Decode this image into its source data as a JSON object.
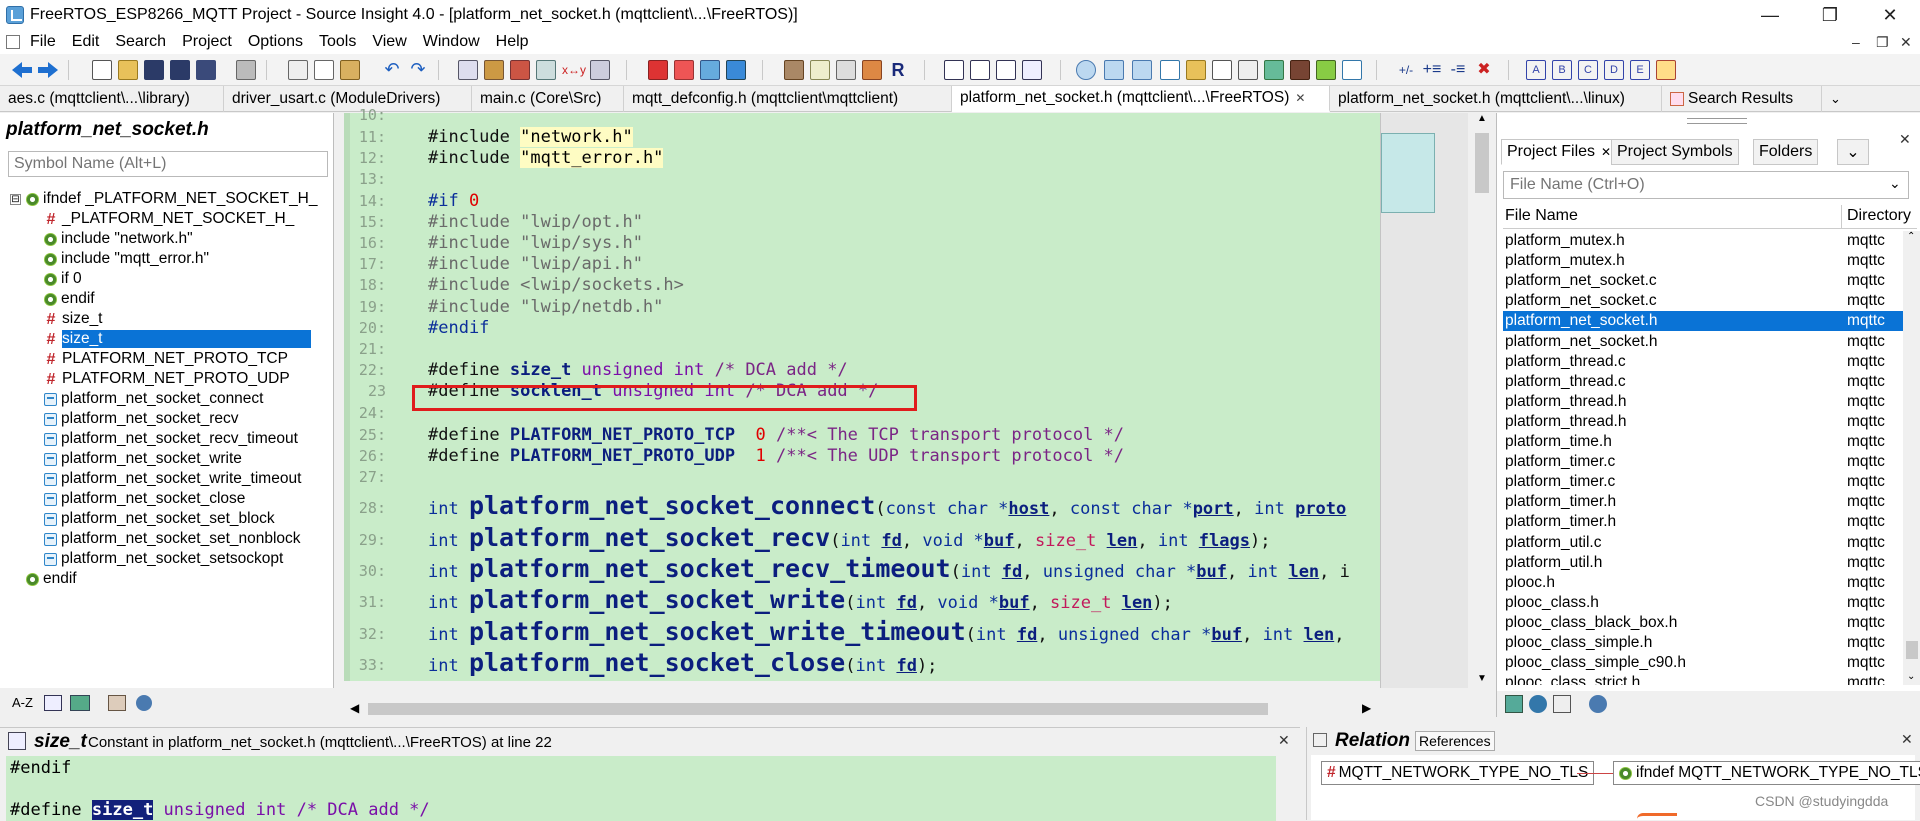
{
  "window": {
    "title": "FreeRTOS_ESP8266_MQTT Project - Source Insight 4.0 - [platform_net_socket.h (mqttclient\\...\\FreeRTOS)]",
    "minimize": "—",
    "maximize": "❐",
    "close": "✕"
  },
  "menu": {
    "items": [
      "File",
      "Edit",
      "Search",
      "Project",
      "Options",
      "Tools",
      "View",
      "Window",
      "Help"
    ],
    "mdi_minimize": "–",
    "mdi_restore": "❐",
    "mdi_close": "✕"
  },
  "tabs": [
    {
      "label": "aes.c (mqttclient\\...\\library)"
    },
    {
      "label": "driver_usart.c (ModuleDrivers)"
    },
    {
      "label": "main.c (Core\\Src)"
    },
    {
      "label": "mqtt_defconfig.h (mqttclient\\mqttclient)"
    },
    {
      "label": "platform_net_socket.h (mqttclient\\...\\FreeRTOS)",
      "close": "✕"
    },
    {
      "label": "platform_net_socket.h (mqttclient\\...\\linux)"
    },
    {
      "label": "Search Results"
    }
  ],
  "symbol_panel": {
    "title": "platform_net_socket.h",
    "search_placeholder": "Symbol Name (Alt+L)",
    "root_expander": "⊟",
    "items": [
      {
        "label": "ifndef _PLATFORM_NET_SOCKET_H_",
        "icon": "gear-icon"
      },
      {
        "label": "_PLATFORM_NET_SOCKET_H_",
        "icon": "hash-icon"
      },
      {
        "label": "include \"network.h\"",
        "icon": "gear-icon"
      },
      {
        "label": "include \"mqtt_error.h\"",
        "icon": "gear-icon"
      },
      {
        "label": "if 0",
        "icon": "gear-icon"
      },
      {
        "label": "endif",
        "icon": "gear-icon"
      },
      {
        "label": "size_t",
        "icon": "hash-icon"
      },
      {
        "label": "size_t",
        "icon": "hash-icon",
        "selected": true
      },
      {
        "label": "PLATFORM_NET_PROTO_TCP",
        "icon": "hash-icon"
      },
      {
        "label": "PLATFORM_NET_PROTO_UDP",
        "icon": "hash-icon"
      },
      {
        "label": "platform_net_socket_connect",
        "icon": "function-icon"
      },
      {
        "label": "platform_net_socket_recv",
        "icon": "function-icon"
      },
      {
        "label": "platform_net_socket_recv_timeout",
        "icon": "function-icon"
      },
      {
        "label": "platform_net_socket_write",
        "icon": "function-icon"
      },
      {
        "label": "platform_net_socket_write_timeout",
        "icon": "function-icon"
      },
      {
        "label": "platform_net_socket_close",
        "icon": "function-icon"
      },
      {
        "label": "platform_net_socket_set_block",
        "icon": "function-icon"
      },
      {
        "label": "platform_net_socket_set_nonblock",
        "icon": "function-icon"
      },
      {
        "label": "platform_net_socket_setsockopt",
        "icon": "function-icon"
      },
      {
        "label": "endif",
        "icon": "gear-icon"
      }
    ],
    "footer_sort": "A-Z"
  },
  "editor": {
    "lines": [
      {
        "n": "10:",
        "tokens": []
      },
      {
        "n": "11:",
        "tokens": [
          [
            "pre",
            "#include "
          ],
          [
            "str",
            "\"network.h\""
          ]
        ]
      },
      {
        "n": "12:",
        "tokens": [
          [
            "pre",
            "#include "
          ],
          [
            "str",
            "\"mqtt_error.h\""
          ]
        ]
      },
      {
        "n": "13:",
        "tokens": []
      },
      {
        "n": "14:",
        "tokens": [
          [
            "kw",
            "#if "
          ],
          [
            "num",
            "0"
          ]
        ]
      },
      {
        "n": "15:",
        "tokens": [
          [
            "gray",
            "#include \"lwip/opt.h\""
          ]
        ]
      },
      {
        "n": "16:",
        "tokens": [
          [
            "gray",
            "#include \"lwip/sys.h\""
          ]
        ]
      },
      {
        "n": "17:",
        "tokens": [
          [
            "gray",
            "#include \"lwip/api.h\""
          ]
        ]
      },
      {
        "n": "18:",
        "tokens": [
          [
            "gray",
            "#include <lwip/sockets.h>"
          ]
        ]
      },
      {
        "n": "19:",
        "tokens": [
          [
            "gray",
            "#include \"lwip/netdb.h\""
          ]
        ]
      },
      {
        "n": "20:",
        "tokens": [
          [
            "kw",
            "#endif"
          ]
        ]
      },
      {
        "n": "21:",
        "tokens": []
      },
      {
        "n": "22:",
        "tokens": [
          [
            "pre",
            "#define "
          ],
          [
            "ident",
            "size_t"
          ],
          [
            "type",
            " unsigned int "
          ],
          [
            "cmt",
            "/* DCA add */"
          ]
        ]
      },
      {
        "n": "23",
        "tokens": [
          [
            "pre",
            "#define "
          ],
          [
            "ident",
            "socklen_t"
          ],
          [
            "type",
            " unsigned int "
          ],
          [
            "cmt",
            "/* DCA add */"
          ]
        ]
      },
      {
        "n": "24:",
        "tokens": []
      },
      {
        "n": "25:",
        "tokens": [
          [
            "pre",
            "#define "
          ],
          [
            "ident",
            "PLATFORM_NET_PROTO_TCP"
          ],
          [
            "pre",
            "  "
          ],
          [
            "num",
            "0"
          ],
          [
            "cmt",
            " /**< The TCP transport protocol */"
          ]
        ]
      },
      {
        "n": "26:",
        "tokens": [
          [
            "pre",
            "#define "
          ],
          [
            "ident",
            "PLATFORM_NET_PROTO_UDP"
          ],
          [
            "pre",
            "  "
          ],
          [
            "num",
            "1"
          ],
          [
            "cmt",
            " /**< The UDP transport protocol */"
          ]
        ]
      },
      {
        "n": "27:",
        "tokens": []
      },
      {
        "n": "28:",
        "big": true,
        "tokens": [
          [
            "kw",
            "int "
          ],
          [
            "func",
            "platform_net_socket_connect"
          ],
          [
            "pre",
            "("
          ],
          [
            "kw",
            "const char *"
          ],
          [
            "param",
            "host"
          ],
          [
            "pre",
            ", "
          ],
          [
            "kw",
            "const char *"
          ],
          [
            "param",
            "port"
          ],
          [
            "pre",
            ", "
          ],
          [
            "kw",
            "int "
          ],
          [
            "param",
            "proto"
          ]
        ]
      },
      {
        "n": "29:",
        "big": true,
        "tokens": [
          [
            "kw",
            "int "
          ],
          [
            "func",
            "platform_net_socket_recv"
          ],
          [
            "pre",
            "("
          ],
          [
            "kw",
            "int "
          ],
          [
            "param",
            "fd"
          ],
          [
            "pre",
            ", "
          ],
          [
            "kw",
            "void *"
          ],
          [
            "param",
            "buf"
          ],
          [
            "pre",
            ", "
          ],
          [
            "sizet",
            "size_t "
          ],
          [
            "param",
            "len"
          ],
          [
            "pre",
            ", "
          ],
          [
            "kw",
            "int "
          ],
          [
            "param",
            "flags"
          ],
          [
            "pre",
            ");"
          ]
        ]
      },
      {
        "n": "30:",
        "big": true,
        "tokens": [
          [
            "kw",
            "int "
          ],
          [
            "func",
            "platform_net_socket_recv_timeout"
          ],
          [
            "pre",
            "("
          ],
          [
            "kw",
            "int "
          ],
          [
            "param",
            "fd"
          ],
          [
            "pre",
            ", "
          ],
          [
            "kw",
            "unsigned char *"
          ],
          [
            "param",
            "buf"
          ],
          [
            "pre",
            ", "
          ],
          [
            "kw",
            "int "
          ],
          [
            "param",
            "len"
          ],
          [
            "pre",
            ", i"
          ]
        ]
      },
      {
        "n": "31:",
        "big": true,
        "tokens": [
          [
            "kw",
            "int "
          ],
          [
            "func",
            "platform_net_socket_write"
          ],
          [
            "pre",
            "("
          ],
          [
            "kw",
            "int "
          ],
          [
            "param",
            "fd"
          ],
          [
            "pre",
            ", "
          ],
          [
            "kw",
            "void *"
          ],
          [
            "param",
            "buf"
          ],
          [
            "pre",
            ", "
          ],
          [
            "sizet",
            "size_t "
          ],
          [
            "param",
            "len"
          ],
          [
            "pre",
            ");"
          ]
        ]
      },
      {
        "n": "32:",
        "big": true,
        "tokens": [
          [
            "kw",
            "int "
          ],
          [
            "func",
            "platform_net_socket_write_timeout"
          ],
          [
            "pre",
            "("
          ],
          [
            "kw",
            "int "
          ],
          [
            "param",
            "fd"
          ],
          [
            "pre",
            ", "
          ],
          [
            "kw",
            "unsigned char *"
          ],
          [
            "param",
            "buf"
          ],
          [
            "pre",
            ", "
          ],
          [
            "kw",
            "int "
          ],
          [
            "param",
            "len"
          ],
          [
            "pre",
            ","
          ]
        ]
      },
      {
        "n": "33:",
        "big": true,
        "tokens": [
          [
            "kw",
            "int "
          ],
          [
            "func",
            "platform_net_socket_close"
          ],
          [
            "pre",
            "("
          ],
          [
            "kw",
            "int "
          ],
          [
            "param",
            "fd"
          ],
          [
            "pre",
            ");"
          ]
        ]
      }
    ]
  },
  "project_panel": {
    "tabs": [
      "Project Files",
      "Project Symbols",
      "Folders"
    ],
    "tab_close": "✕",
    "search_placeholder": "File Name (Ctrl+O)",
    "col_name": "File Name",
    "col_dir": "Directory",
    "files": [
      {
        "name": "platform_mutex.h",
        "dir": "mqttc"
      },
      {
        "name": "platform_mutex.h",
        "dir": "mqttc"
      },
      {
        "name": "platform_net_socket.c",
        "dir": "mqttc"
      },
      {
        "name": "platform_net_socket.c",
        "dir": "mqttc"
      },
      {
        "name": "platform_net_socket.h",
        "dir": "mqttc",
        "selected": true
      },
      {
        "name": "platform_net_socket.h",
        "dir": "mqttc"
      },
      {
        "name": "platform_thread.c",
        "dir": "mqttc"
      },
      {
        "name": "platform_thread.c",
        "dir": "mqttc"
      },
      {
        "name": "platform_thread.h",
        "dir": "mqttc"
      },
      {
        "name": "platform_thread.h",
        "dir": "mqttc"
      },
      {
        "name": "platform_time.h",
        "dir": "mqttc"
      },
      {
        "name": "platform_timer.c",
        "dir": "mqttc"
      },
      {
        "name": "platform_timer.c",
        "dir": "mqttc"
      },
      {
        "name": "platform_timer.h",
        "dir": "mqttc"
      },
      {
        "name": "platform_timer.h",
        "dir": "mqttc"
      },
      {
        "name": "platform_util.c",
        "dir": "mqttc"
      },
      {
        "name": "platform_util.h",
        "dir": "mqttc"
      },
      {
        "name": "plooc.h",
        "dir": "mqttc"
      },
      {
        "name": "plooc_class.h",
        "dir": "mqttc"
      },
      {
        "name": "plooc_class_black_box.h",
        "dir": "mqttc"
      },
      {
        "name": "plooc_class_simple.h",
        "dir": "mqttc"
      },
      {
        "name": "plooc_class_simple_c90.h",
        "dir": "mqttc"
      },
      {
        "name": "plooc_class_strict.h",
        "dir": "mqttc"
      }
    ]
  },
  "context_window": {
    "symbol": "size_t",
    "desc": "Constant in platform_net_socket.h (mqttclient\\...\\FreeRTOS) at line 22",
    "close": "✕",
    "line1": "#endif",
    "line2_pre": "#define ",
    "line2_ident": "size_t",
    "line2_rest": " unsigned int /* DCA add */"
  },
  "relation_window": {
    "title": "Relation",
    "tab": "References",
    "close": "✕",
    "node1": "MQTT_NETWORK_TYPE_NO_TLS",
    "node2": "ifndef MQTT_NETWORK_TYPE_NO_TLS"
  },
  "watermark": "CSDN @studyingdda",
  "colors": {
    "selection": "#0a73d6",
    "editor_bg": "#c9ecc9",
    "highlight_box": "#e01c1c"
  }
}
